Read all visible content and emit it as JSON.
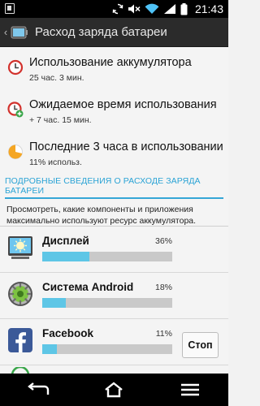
{
  "status_bar": {
    "time": "21:43",
    "icons": [
      "screenshot-icon",
      "sync-icon",
      "mute-icon",
      "wifi-icon",
      "signal-icon",
      "battery-icon"
    ]
  },
  "header": {
    "title": "Расход заряда батареи"
  },
  "summary": [
    {
      "title": "Использование аккумулятора",
      "subtitle": "25 час. 3 мин.",
      "icon": "clock-icon"
    },
    {
      "title": "Ожидаемое время использования",
      "subtitle": "+ 7 час. 15 мин.",
      "icon": "clock-plus-icon"
    },
    {
      "title": "Последние 3 часа в использовании",
      "subtitle": "11% использ.",
      "icon": "pie-icon"
    }
  ],
  "details": {
    "header": "ПОДРОБНЫЕ СВЕДЕНИЯ О РАСХОДЕ ЗАРЯДА БАТАРЕИ",
    "description": "Просмотреть, какие компоненты и приложения максимально используют ресурс аккумулятора."
  },
  "apps": [
    {
      "name": "Дисплей",
      "percent_label": "36%",
      "percent": 36,
      "icon": "display-icon"
    },
    {
      "name": "Система Android",
      "percent_label": "18%",
      "percent": 18,
      "icon": "android-system-icon"
    },
    {
      "name": "Facebook",
      "percent_label": "11%",
      "percent": 11,
      "icon": "facebook-icon",
      "stop_label": "Стоп"
    }
  ],
  "navigation": [
    "back-icon",
    "home-icon",
    "menu-icon"
  ],
  "colors": {
    "accent": "#2aa3d5",
    "bar_fill": "#5ec6e6",
    "bar_track": "#c9c9c9",
    "action_bar": "#2b2b2b",
    "facebook": "#3b5998"
  }
}
